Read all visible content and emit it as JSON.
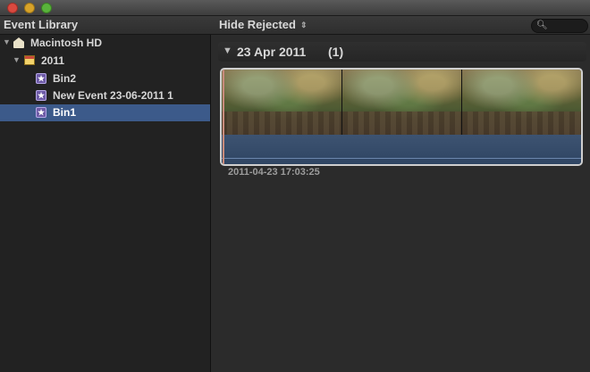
{
  "window": {
    "traffic_lights": [
      "close",
      "minimize",
      "zoom"
    ]
  },
  "toolbar": {
    "library_title": "Event Library",
    "filter_label": "Hide Rejected",
    "filter_arrows": "⇕",
    "search_icon": "search-icon"
  },
  "sidebar": {
    "items": [
      {
        "label": "Macintosh HD",
        "icon": "hard-drive-icon",
        "level": 0,
        "expanded": true,
        "selected": false
      },
      {
        "label": "2011",
        "icon": "calendar-icon",
        "level": 1,
        "expanded": true,
        "selected": false
      },
      {
        "label": "Bin2",
        "icon": "event-star-icon",
        "level": 2,
        "selected": false
      },
      {
        "label": "New Event 23-06-2011 1",
        "icon": "event-star-icon",
        "level": 2,
        "selected": false
      },
      {
        "label": "Bin1",
        "icon": "event-star-icon",
        "level": 2,
        "selected": true
      }
    ]
  },
  "browser": {
    "group_date": "23 Apr 2011",
    "group_count": "(1)",
    "clip_timestamp": "2011-04-23 17:03:25"
  },
  "colors": {
    "selection": "#3c5a8a",
    "audio": "#3d5371",
    "clip_border": "#cfcfcf"
  }
}
